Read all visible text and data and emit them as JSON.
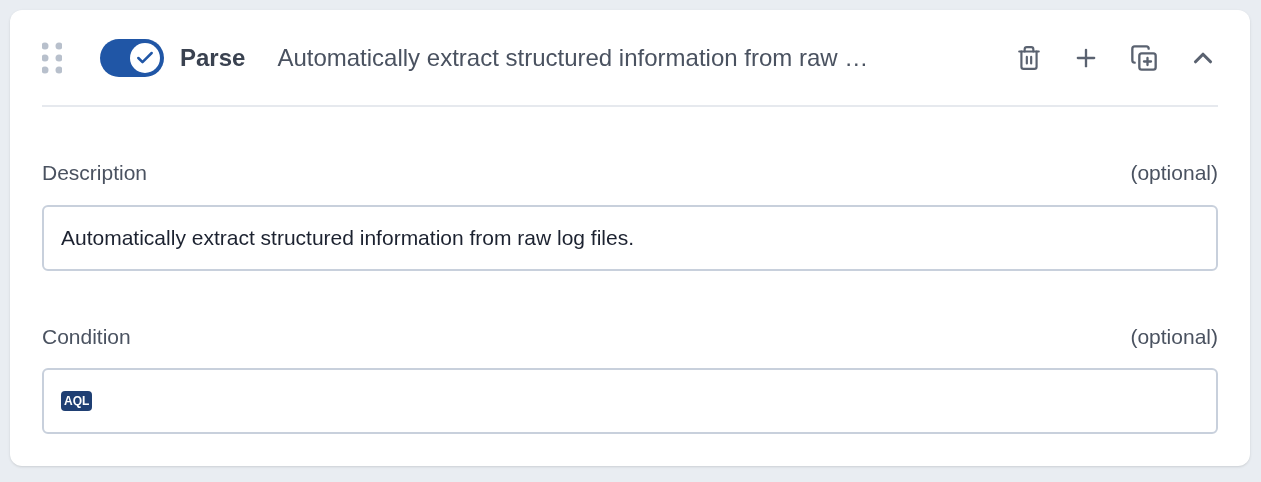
{
  "header": {
    "enabled": true,
    "title": "Parse",
    "summary": "Automatically extract structured information from raw …",
    "expanded": true
  },
  "fields": [
    {
      "label": "Description",
      "hint": "(optional)",
      "value": "Automatically extract structured information from raw log files."
    },
    {
      "label": "Condition",
      "hint": "(optional)",
      "badge": "AQL"
    }
  ]
}
